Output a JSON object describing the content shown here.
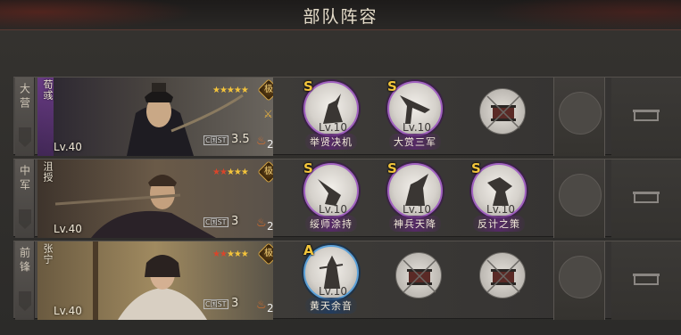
{
  "header": {
    "title": "部队阵容"
  },
  "rows": [
    {
      "position": "大营",
      "general": {
        "name": "荀彧",
        "level": "Lv.40",
        "stars_gold": "★★★★★",
        "stars_red": "",
        "rank": "极",
        "cost_tag": "C国ST",
        "cost": "3.5",
        "fire_count": "2"
      },
      "skills": [
        {
          "grade": "S",
          "level": "Lv.10",
          "name": "举贤决机"
        },
        {
          "grade": "S",
          "level": "Lv.10",
          "name": "大赏三军"
        }
      ]
    },
    {
      "position": "中军",
      "general": {
        "name": "沮授",
        "level": "Lv.40",
        "stars_gold": "★★★",
        "stars_red": "★★",
        "rank": "极",
        "cost_tag": "C国ST",
        "cost": "3",
        "fire_count": "2"
      },
      "skills": [
        {
          "grade": "S",
          "level": "Lv.10",
          "name": "绥师涂持"
        },
        {
          "grade": "S",
          "level": "Lv.10",
          "name": "神兵天降"
        },
        {
          "grade": "S",
          "level": "Lv.10",
          "name": "反计之策"
        }
      ]
    },
    {
      "position": "前锋",
      "general": {
        "name": "张宁",
        "level": "Lv.40",
        "stars_gold": "★★★",
        "stars_red": "★★",
        "rank": "极",
        "cost_tag": "C国ST",
        "cost": "3",
        "fire_count": "2"
      },
      "skills": [
        {
          "grade": "A",
          "level": "Lv.10",
          "name": "黄天余音"
        }
      ]
    }
  ],
  "colors": {
    "s_grade_ring": "#a060c0",
    "a_grade_ring": "#5ba0d8",
    "grade_text": "#f2c53b"
  }
}
